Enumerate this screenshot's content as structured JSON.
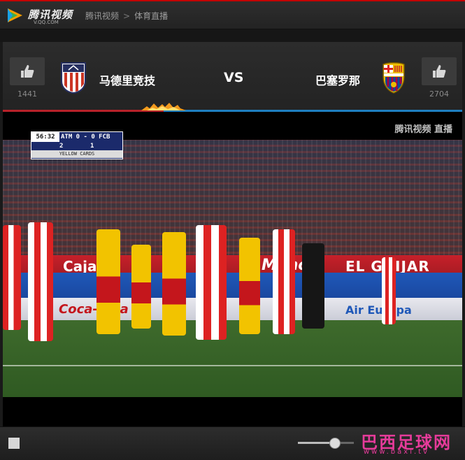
{
  "header": {
    "logo_text": "腾讯视频",
    "logo_sub": "V.QQ.COM",
    "breadcrumb": [
      "腾讯视频",
      "体育直播"
    ],
    "breadcrumb_sep": ">"
  },
  "match": {
    "home": {
      "name": "马德里竞技",
      "likes": "1441",
      "crest_colors": [
        "#cb3524",
        "#ffffff",
        "#262f61"
      ]
    },
    "vs": "VS",
    "away": {
      "name": "巴塞罗那",
      "likes": "2704",
      "crest_colors": [
        "#a50044",
        "#004d98",
        "#edbb00"
      ]
    },
    "like_icon": "thumbs-up-icon",
    "home_share": 0.35,
    "accent_colors": {
      "home": "#b8222a",
      "away": "#1e7fc0"
    }
  },
  "video": {
    "watermark": "腾讯视频 直播",
    "scoreboard": {
      "time": "56:32",
      "score": "ATM 0 - 0 FCB",
      "home_yellow": "2",
      "away_yellow": "1",
      "cards_label": "YELLOW CARDS"
    },
    "boards": {
      "main": "Mahou",
      "side": "EL GUIJAR",
      "left": "Caja",
      "europa": "Air Europa",
      "coke": "Coca-Cola"
    }
  },
  "controls": {
    "stop_icon": "stop-icon",
    "volume_level": 0.65
  },
  "watermark_site": {
    "name": "巴西足球网",
    "url": "www.baxi.tv"
  }
}
